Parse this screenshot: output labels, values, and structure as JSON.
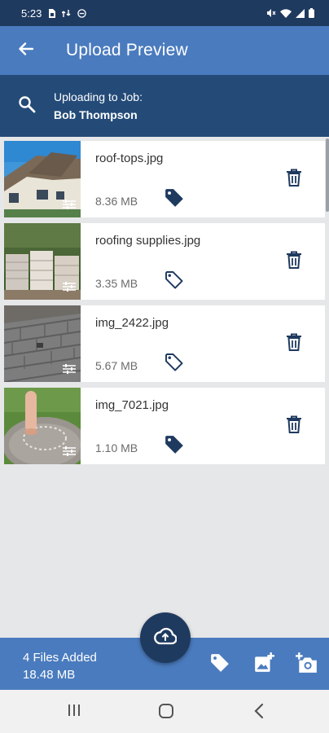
{
  "status_bar": {
    "time": "5:23",
    "left_icons": [
      "sim-card-icon",
      "data-saver-icon",
      "do-not-disturb-icon"
    ],
    "right_icons": [
      "mute-icon",
      "wifi-icon",
      "signal-icon",
      "battery-icon"
    ]
  },
  "app_bar": {
    "back_icon": "arrow-left-icon",
    "title": "Upload Preview"
  },
  "job": {
    "search_icon": "search-icon",
    "label": "Uploading to Job:",
    "name": "Bob Thompson"
  },
  "files": [
    {
      "name": "roof-tops.jpg",
      "size": "8.36 MB",
      "tagged": true,
      "thumbnail": "houses with roofs"
    },
    {
      "name": "roofing supplies.jpg",
      "size": "3.35 MB",
      "tagged": false,
      "thumbnail": "pallets of roofing supplies"
    },
    {
      "name": "img_2422.jpg",
      "size": "5.67 MB",
      "tagged": false,
      "thumbnail": "shingle roof close-up"
    },
    {
      "name": "img_7021.jpg",
      "size": "1.10 MB",
      "tagged": true,
      "thumbnail": "finger on gravel"
    }
  ],
  "bottom_bar": {
    "files_added": "4 Files Added",
    "total_size": "18.48 MB",
    "fab_icon": "cloud-upload-icon",
    "actions": [
      "tag-icon",
      "add-image-icon",
      "add-photo-camera-icon"
    ]
  },
  "nav_bar": {
    "buttons": [
      "recent-apps-icon",
      "home-icon",
      "back-icon"
    ]
  },
  "colors": {
    "status_bar": "#1f3a5f",
    "app_bar": "#4a7bbe",
    "job_bar": "#244b78",
    "icon_dark": "#1f3a5f",
    "background": "#e6e7e9"
  }
}
